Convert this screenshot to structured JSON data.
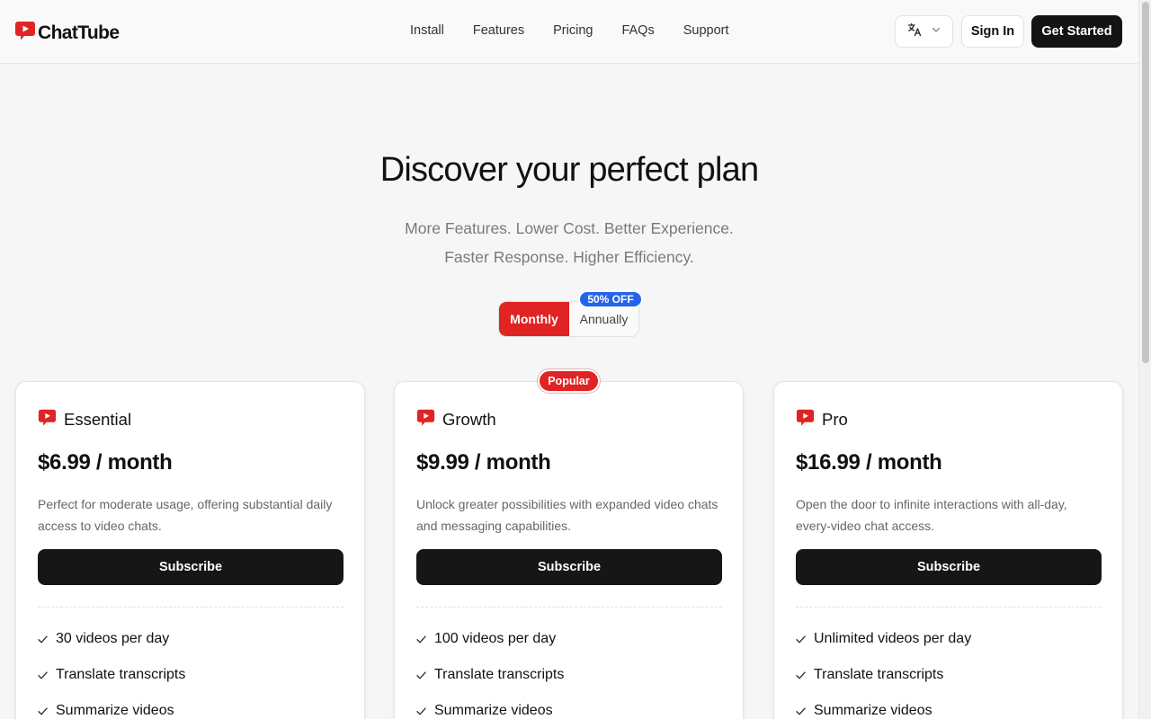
{
  "brand": {
    "name": "ChatTube",
    "accent": "#e02424"
  },
  "nav": {
    "items": [
      {
        "label": "Install"
      },
      {
        "label": "Features"
      },
      {
        "label": "Pricing"
      },
      {
        "label": "FAQs"
      },
      {
        "label": "Support"
      }
    ]
  },
  "header": {
    "language_icon": "translate-icon",
    "sign_in_label": "Sign In",
    "get_started_label": "Get Started"
  },
  "hero": {
    "title": "Discover your perfect plan",
    "subtitle_line1": "More Features. Lower Cost. Better Experience.",
    "subtitle_line2": "Faster Response. Higher Efficiency."
  },
  "billing_toggle": {
    "monthly_label": "Monthly",
    "annual_label": "Annually",
    "discount_badge": "50% OFF",
    "selected": "Monthly",
    "badge_color": "#2563eb"
  },
  "popular_badge": "Popular",
  "plans": [
    {
      "name": "Essential",
      "price": "$6.99 / month",
      "description": "Perfect for moderate usage, offering substantial daily access to video chats.",
      "cta": "Subscribe",
      "features": [
        "30 videos per day",
        "Translate transcripts",
        "Summarize videos"
      ]
    },
    {
      "name": "Growth",
      "price": "$9.99 / month",
      "description": "Unlock greater possibilities with expanded video chats and messaging capabilities.",
      "cta": "Subscribe",
      "features": [
        "100 videos per day",
        "Translate transcripts",
        "Summarize videos"
      ]
    },
    {
      "name": "Pro",
      "price": "$16.99 / month",
      "description": "Open the door to infinite interactions with all-day, every-video chat access.",
      "cta": "Subscribe",
      "features": [
        "Unlimited videos per day",
        "Translate transcripts",
        "Summarize videos"
      ]
    }
  ]
}
